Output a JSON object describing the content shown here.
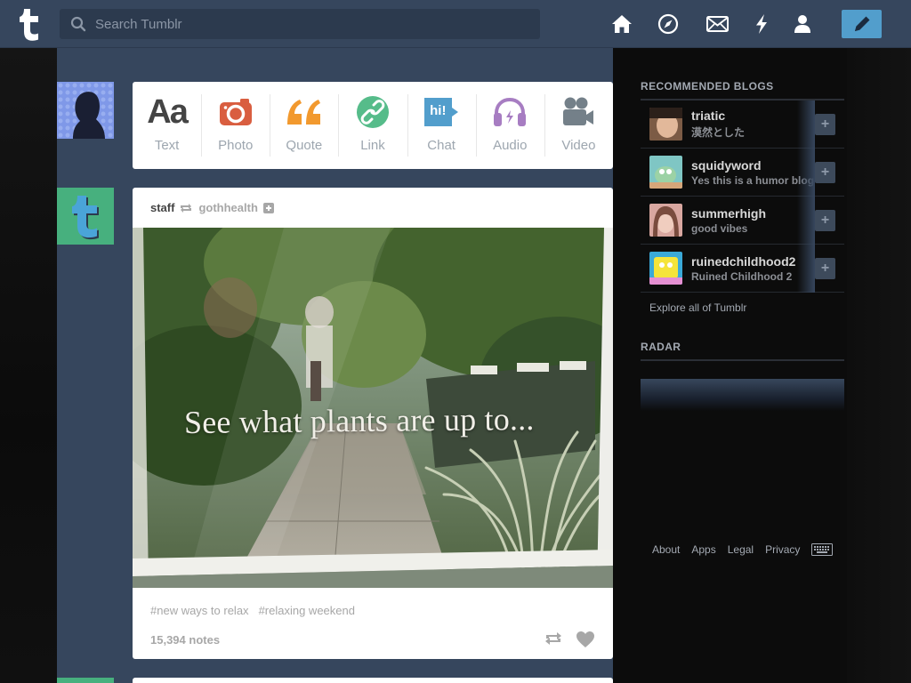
{
  "header": {
    "search_placeholder": "Search Tumblr"
  },
  "post_form": {
    "items": [
      {
        "label": "Text",
        "color": "#444444"
      },
      {
        "label": "Photo",
        "color": "#d95e40"
      },
      {
        "label": "Quote",
        "color": "#f2992e"
      },
      {
        "label": "Link",
        "color": "#56bc8a"
      },
      {
        "label": "Chat",
        "color": "#529ecc"
      },
      {
        "label": "Audio",
        "color": "#a77dc2"
      },
      {
        "label": "Video",
        "color": "#748089"
      }
    ],
    "text_glyph": "Aa",
    "chat_glyph": "hi!"
  },
  "post": {
    "author": "staff",
    "reblogged_from": "gothhealth",
    "photo_caption": "See what plants are up to...",
    "tags": [
      "#new ways to relax",
      "#relaxing weekend"
    ],
    "notes": "15,394 notes"
  },
  "sidebar": {
    "recommended_title": "RECOMMENDED BLOGS",
    "blogs": [
      {
        "name": "triatic",
        "subtitle": "漠然とした"
      },
      {
        "name": "squidyword",
        "subtitle": "Yes this is a humor blog"
      },
      {
        "name": "summerhigh",
        "subtitle": "good vibes"
      },
      {
        "name": "ruinedchildhood2",
        "subtitle": "Ruined Childhood 2"
      }
    ],
    "explore_label": "Explore all of Tumblr",
    "radar_title": "RADAR"
  },
  "footer": {
    "links": [
      "About",
      "Apps",
      "Legal",
      "Privacy"
    ]
  },
  "colors": {
    "header_bg": "#36465d",
    "compose_bg": "#529ecc",
    "dash_bg": "#36465d"
  }
}
